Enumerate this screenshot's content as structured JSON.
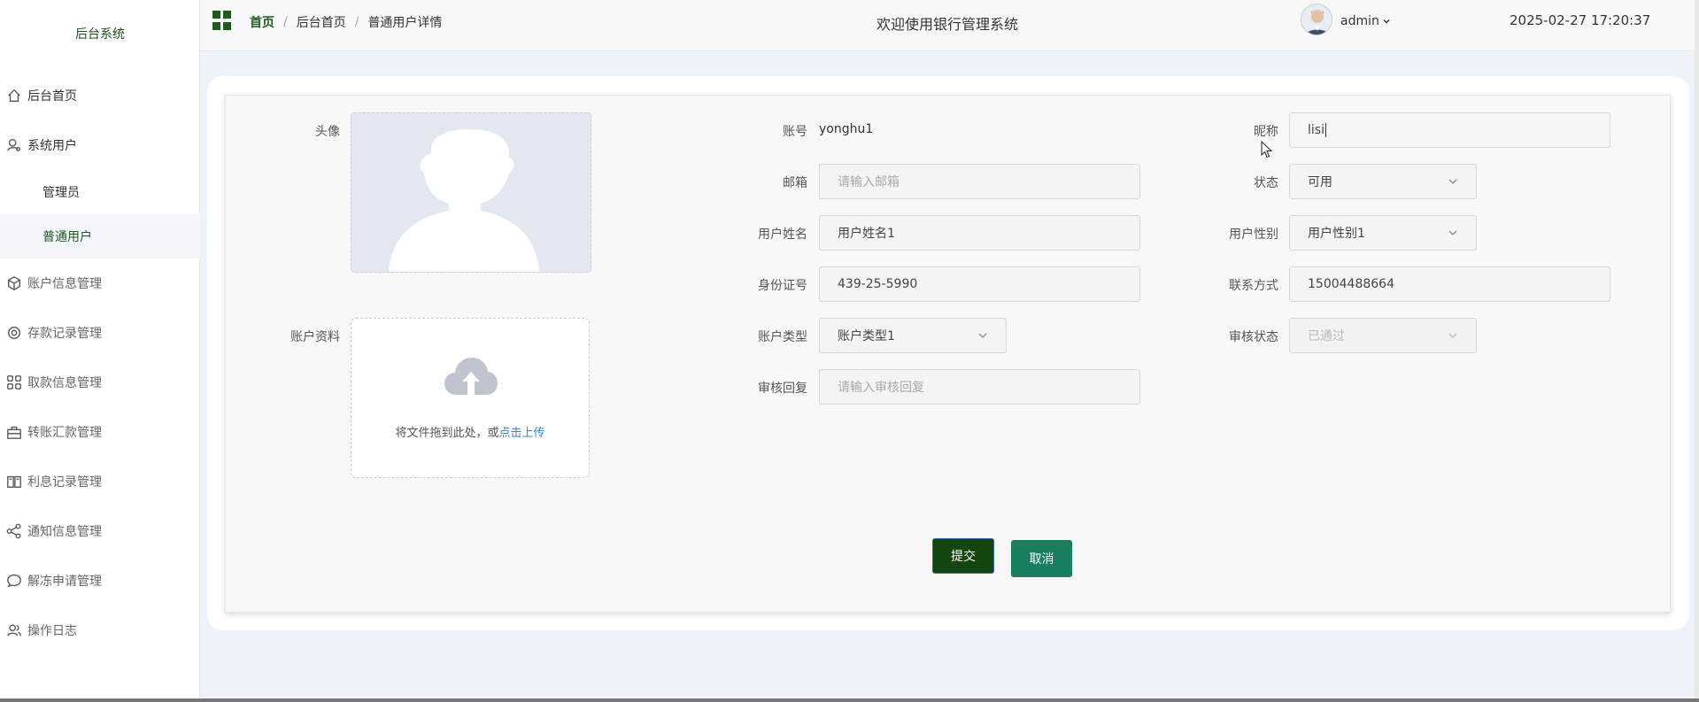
{
  "sidebar": {
    "brand": "后台系统",
    "items": [
      {
        "label": "后台首页",
        "icon": "home-icon"
      },
      {
        "label": "系统用户",
        "icon": "user-gear-icon"
      },
      {
        "label": "账户信息管理",
        "icon": "box-icon"
      },
      {
        "label": "存款记录管理",
        "icon": "gear-icon"
      },
      {
        "label": "取款信息管理",
        "icon": "grid-icon"
      },
      {
        "label": "转账汇款管理",
        "icon": "briefcase-icon"
      },
      {
        "label": "利息记录管理",
        "icon": "book-icon"
      },
      {
        "label": "通知信息管理",
        "icon": "share-icon"
      },
      {
        "label": "解冻申请管理",
        "icon": "chat-icon"
      },
      {
        "label": "操作日志",
        "icon": "users-icon"
      }
    ],
    "submenu": [
      {
        "label": "管理员"
      },
      {
        "label": "普通用户"
      }
    ]
  },
  "header": {
    "breadcrumb": [
      "首页",
      "后台首页",
      "普通用户详情"
    ],
    "welcome": "欢迎使用银行管理系统",
    "user": "admin",
    "datetime": "2025-02-27 17:20:37"
  },
  "form": {
    "avatar_label": "头像",
    "account_label": "账号",
    "account_value": "yonghu1",
    "nickname_label": "昵称",
    "nickname_value": "lisi",
    "email_label": "邮箱",
    "email_placeholder": "请输入邮箱",
    "status_label": "状态",
    "status_value": "可用",
    "name_label": "用户姓名",
    "name_value": "用户姓名1",
    "gender_label": "用户性别",
    "gender_value": "用户性别1",
    "id_label": "身份证号",
    "id_value": "439-25-5990",
    "phone_label": "联系方式",
    "phone_value": "15004488664",
    "acct_material_label": "账户资料",
    "upload_text": "将文件拖到此处，或",
    "upload_link": "点击上传",
    "acct_type_label": "账户类型",
    "acct_type_value": "账户类型1",
    "audit_status_label": "审核状态",
    "audit_status_value": "已通过",
    "audit_reply_label": "审核回复",
    "audit_reply_placeholder": "请输入审核回复",
    "submit_label": "提交",
    "cancel_label": "取消"
  },
  "colors": {
    "accent": "#1f5a1f",
    "submit": "#15460f",
    "cancel": "#168060",
    "link": "#3a86c8"
  }
}
